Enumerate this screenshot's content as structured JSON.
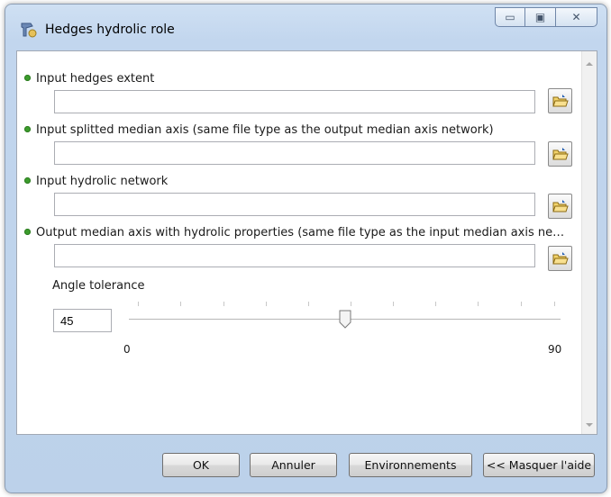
{
  "window": {
    "title": "Hedges hydrolic role"
  },
  "window_controls": {
    "minimize": "▭",
    "maximize": "▣",
    "close": "✕"
  },
  "params": [
    {
      "label": "Input hedges extent",
      "value": ""
    },
    {
      "label": "Input splitted median axis (same file type as the output median axis network)",
      "value": ""
    },
    {
      "label": "Input hydrolic network",
      "value": ""
    },
    {
      "label": "Output median axis with hydrolic properties (same file type as the input median axis ne…",
      "value": ""
    }
  ],
  "angle": {
    "label": "Angle tolerance",
    "value": "45",
    "min_label": "0",
    "max_label": "90",
    "min": 0,
    "max": 90,
    "current": 45
  },
  "buttons": {
    "ok": "OK",
    "cancel": "Annuler",
    "environments": "Environnements",
    "hide_help": "<< Masquer l'aide"
  },
  "colors": {
    "required_bullet": "#3c9c2c",
    "frame": "#c2d6ee"
  },
  "icons": {
    "app": "tool-icon",
    "browse": "open-folder-icon",
    "required": "green-dot-icon"
  }
}
